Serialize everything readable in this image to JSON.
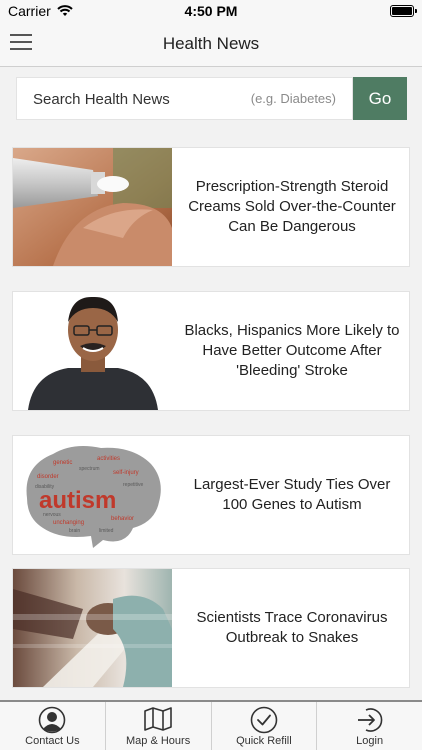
{
  "status_bar": {
    "carrier": "Carrier",
    "time": "4:50 PM"
  },
  "nav": {
    "title": "Health News",
    "menu_icon": "hamburger-menu-icon"
  },
  "search": {
    "label": "Search Health News",
    "hint": "(e.g. Diabetes)",
    "button": "Go"
  },
  "articles": [
    {
      "headline": "Prescription-Strength Steroid Creams Sold Over-the-Counter Can Be Dangerous",
      "image": "cream-tube-photo"
    },
    {
      "headline": "Blacks, Hispanics More Likely to Have Better Outcome After 'Bleeding' Stroke",
      "image": "smiling-man-photo"
    },
    {
      "headline": "Largest-Ever Study Ties Over 100 Genes to Autism",
      "image": "autism-word-cloud-brain",
      "image_text": "autism"
    },
    {
      "headline": "Scientists Trace Coronavirus Outbreak to Snakes",
      "image": "medical-staff-motion-blur-photo"
    }
  ],
  "tabs": [
    {
      "label": "Contact Us",
      "icon": "person-icon"
    },
    {
      "label": "Map & Hours",
      "icon": "map-icon"
    },
    {
      "label": "Quick Refill",
      "icon": "checkmark-circle-icon"
    },
    {
      "label": "Login",
      "icon": "login-arrow-icon"
    }
  ],
  "colors": {
    "accent": "#4f7c63",
    "background": "#f2f2f2",
    "bar": "#f7f7f7"
  }
}
